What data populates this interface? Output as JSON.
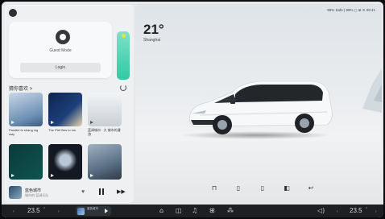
{
  "status_bar": {
    "text": "99% Safe | 99% ◻ ⊕ ≋ 09:41"
  },
  "weather": {
    "temperature": "21°",
    "city": "Shanghai"
  },
  "user_card": {
    "mode": "Guest Mode",
    "login_label": "Login"
  },
  "recommend": {
    "title": "猜你喜欢 >"
  },
  "tiles": [
    {
      "caption": "Parallel to\nshang ing way",
      "color": "#6c8fb3"
    },
    {
      "caption": "The Ptrif Bes\nto ms",
      "color": "#1d3f7a"
    },
    {
      "caption": "蓝调城市 · 大\n城市的漫游",
      "color": "#e2e6ea"
    },
    {
      "caption": "",
      "color": "#0f5450"
    },
    {
      "caption": "",
      "color": "#141822"
    },
    {
      "caption": "",
      "color": "#5a6f84"
    }
  ],
  "mini_player": {
    "title": "蓝色城市",
    "subtitle": "城市的·蓝调乐队"
  },
  "dock": {
    "left_temp": "23.5",
    "left_unit": "°",
    "right_temp": "23.5",
    "right_unit": "°",
    "music_label": "蓝色城市"
  },
  "car_actions": [
    {
      "icon": "lock-icon",
      "glyph": "🔒"
    },
    {
      "icon": "door-icon",
      "glyph": "▯"
    },
    {
      "icon": "trunk-icon",
      "glyph": "▯"
    },
    {
      "icon": "window-icon",
      "glyph": "◧"
    },
    {
      "icon": "return-icon",
      "glyph": "↩"
    }
  ]
}
